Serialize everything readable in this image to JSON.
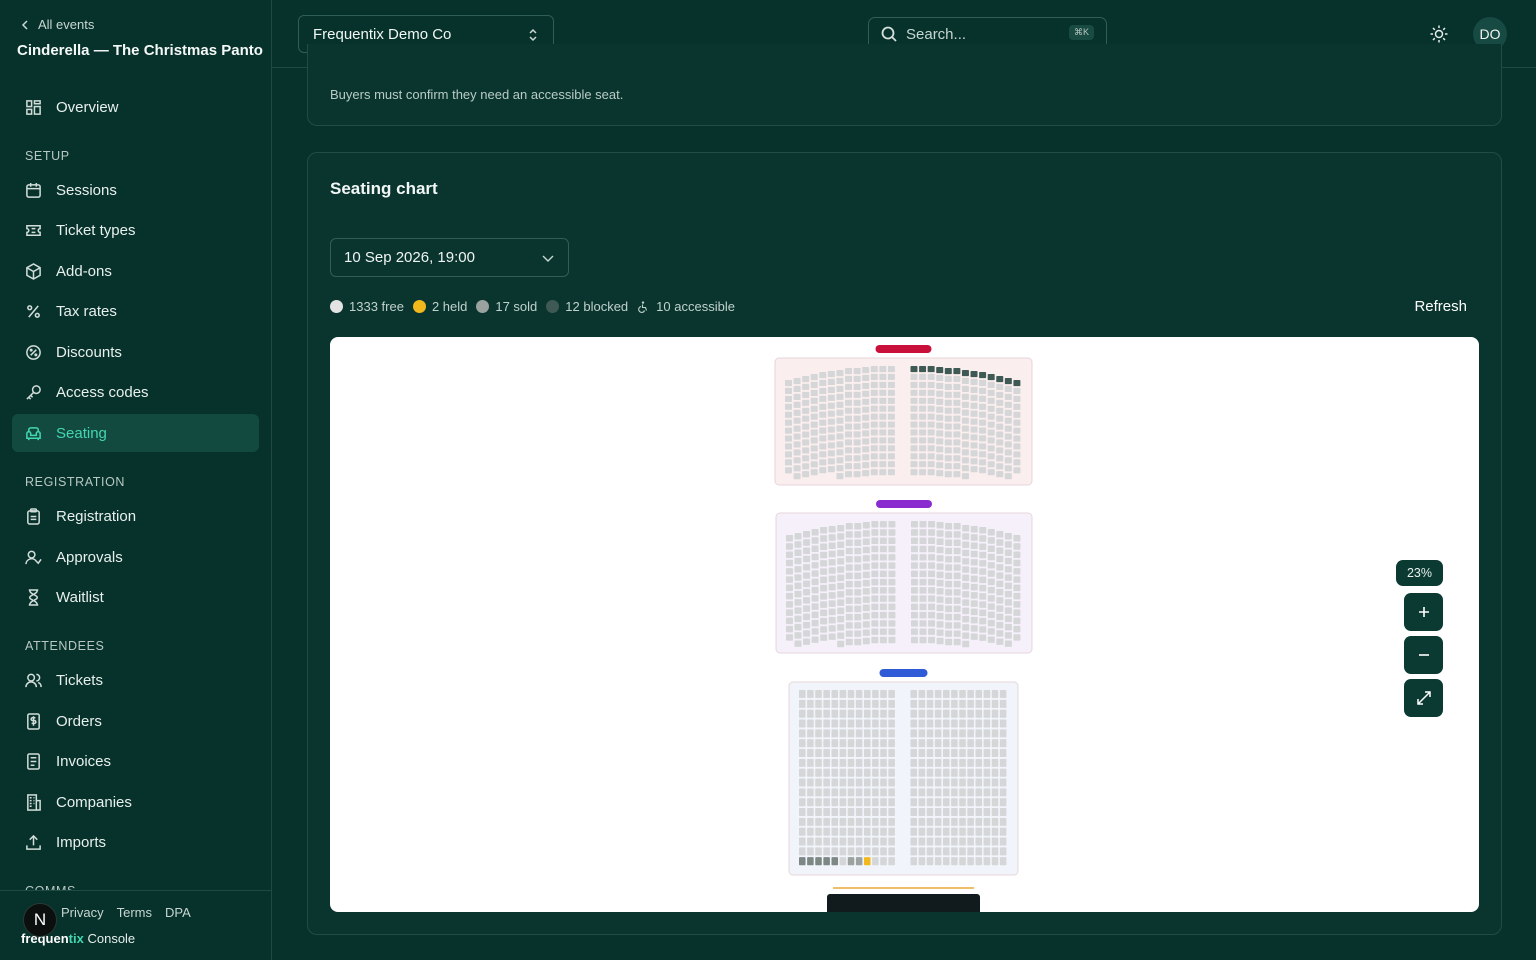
{
  "sidebar": {
    "back_label": "All events",
    "event_title": "Cinderella — The Christmas Panto",
    "overview": "Overview",
    "sections": {
      "setup": "SETUP",
      "registration": "REGISTRATION",
      "attendees": "ATTENDEES",
      "comms": "COMMS"
    },
    "setup_items": [
      "Sessions",
      "Ticket types",
      "Add-ons",
      "Tax rates",
      "Discounts",
      "Access codes",
      "Seating"
    ],
    "registration_items": [
      "Registration",
      "Approvals",
      "Waitlist"
    ],
    "attendee_items": [
      "Tickets",
      "Orders",
      "Invoices",
      "Companies",
      "Imports"
    ],
    "active_item": "Seating",
    "footer_links": [
      "Privacy",
      "Terms",
      "DPA"
    ],
    "brand": {
      "name_a": "frequen",
      "name_b": "tix",
      "suffix": "Console"
    },
    "n_badge": "N"
  },
  "topbar": {
    "org": "Frequentix Demo Co",
    "search_placeholder": "Search...",
    "search_shortcut": "⌘K",
    "avatar": "DO"
  },
  "main": {
    "accessible_note": "Buyers must confirm they need an accessible seat.",
    "seating_title": "Seating chart",
    "session_value": "10 Sep 2026, 19:00",
    "legend": [
      {
        "label": "1333 free",
        "color": "#e3e3e3"
      },
      {
        "label": "2 held",
        "color": "#f2b91c"
      },
      {
        "label": "17 sold",
        "color": "#9aa3a0"
      },
      {
        "label": "12 blocked",
        "color": "#3f5a54"
      },
      {
        "label": "10 accessible",
        "color": "#ffffff"
      }
    ],
    "refresh_label": "Refresh",
    "zoom": "23%",
    "colors": {
      "accent": "#43d7b0",
      "upper_tag": "#c8103a",
      "middle_tag": "#8a2bd0",
      "stalls_tag": "#2f5bd6",
      "stage": "#111a1c"
    }
  }
}
